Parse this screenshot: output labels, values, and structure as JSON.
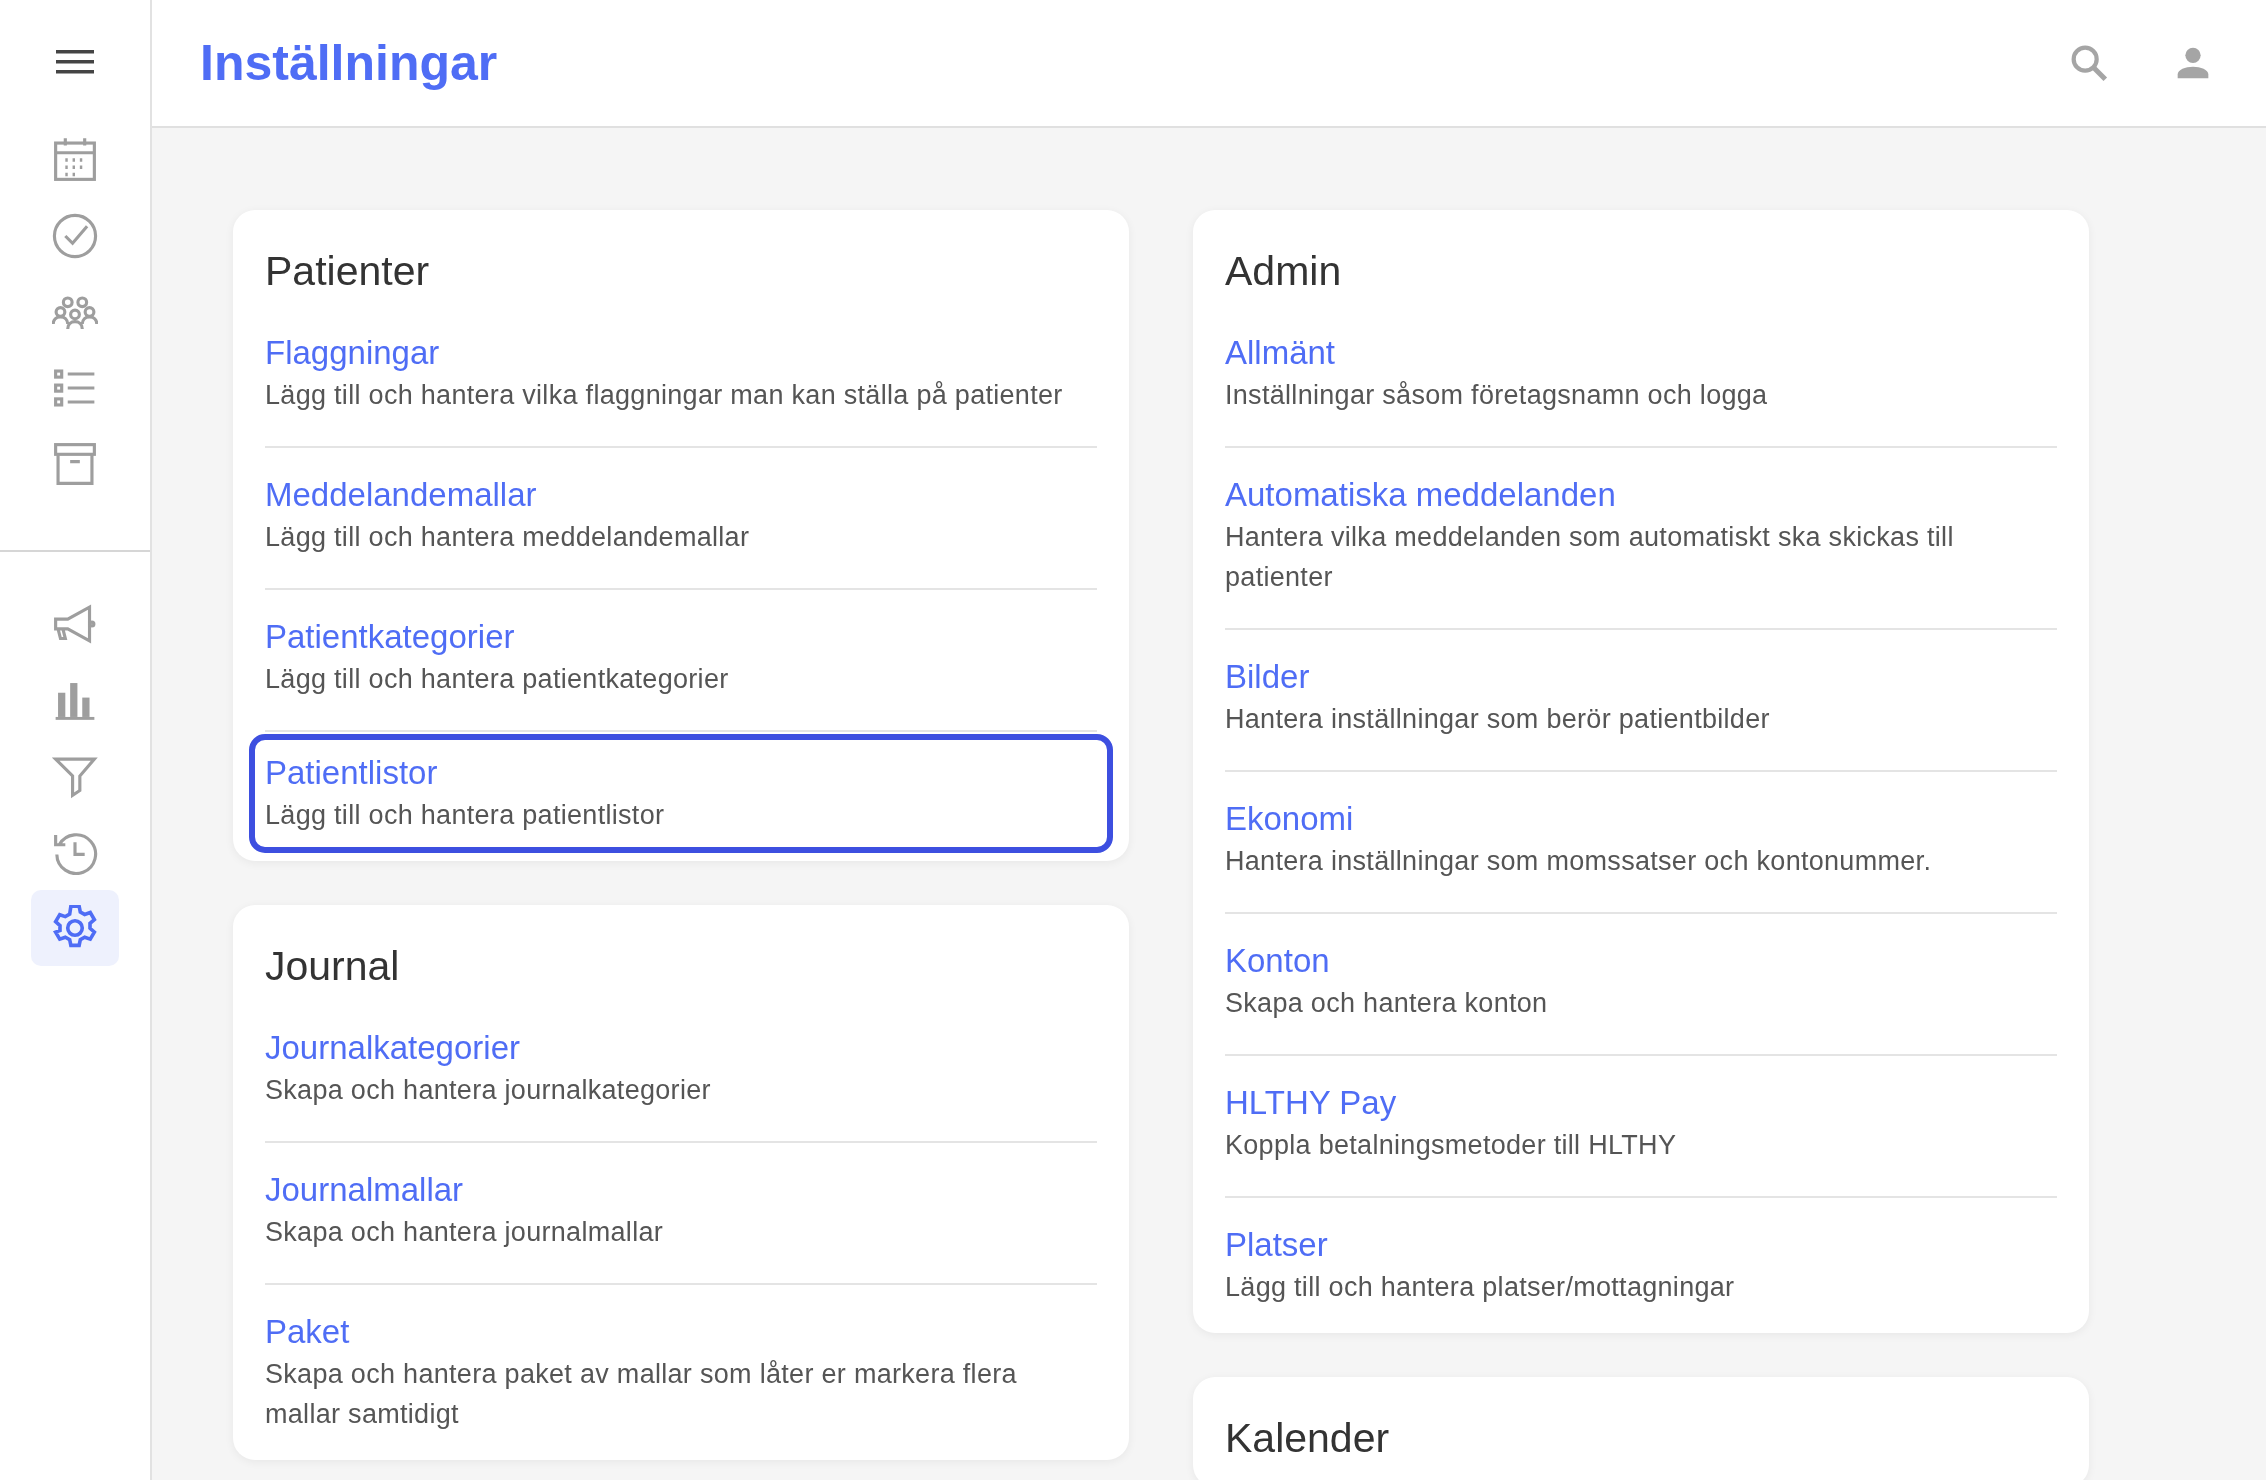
{
  "header": {
    "title": "Inställningar"
  },
  "nav": [
    {
      "kind": "calendar",
      "selected": false
    },
    {
      "kind": "check",
      "selected": false
    },
    {
      "kind": "people",
      "selected": false
    },
    {
      "kind": "list",
      "selected": false
    },
    {
      "kind": "archive",
      "selected": false
    },
    {
      "kind": "divider"
    },
    {
      "kind": "megaphone",
      "selected": false
    },
    {
      "kind": "chart",
      "selected": false
    },
    {
      "kind": "filter",
      "selected": false
    },
    {
      "kind": "history",
      "selected": false
    },
    {
      "kind": "settings",
      "selected": true
    }
  ],
  "columns": [
    [
      {
        "title": "Patienter",
        "items": [
          {
            "title": "Flaggningar",
            "description": "Lägg till och hantera vilka flaggningar man kan ställa på patienter",
            "focused": false
          },
          {
            "title": "Meddelandemallar",
            "description": "Lägg till och hantera meddelandemallar",
            "focused": false
          },
          {
            "title": "Patientkategorier",
            "description": "Lägg till och hantera patientkategorier",
            "focused": false
          },
          {
            "title": "Patientlistor",
            "description": "Lägg till och hantera patientlistor",
            "focused": true
          }
        ]
      },
      {
        "title": "Journal",
        "items": [
          {
            "title": "Journalkategorier",
            "description": "Skapa och hantera journalkategorier",
            "focused": false
          },
          {
            "title": "Journalmallar",
            "description": "Skapa och hantera journalmallar",
            "focused": false
          },
          {
            "title": "Paket",
            "description": "Skapa och hantera paket av mallar som låter er markera flera mallar samtidigt",
            "focused": false
          }
        ]
      }
    ],
    [
      {
        "title": "Admin",
        "items": [
          {
            "title": "Allmänt",
            "description": "Inställningar såsom företagsnamn och logga",
            "focused": false
          },
          {
            "title": "Automatiska meddelanden",
            "description": "Hantera vilka meddelanden som automatiskt ska skickas till patienter",
            "focused": false
          },
          {
            "title": "Bilder",
            "description": "Hantera inställningar som berör patientbilder",
            "focused": false
          },
          {
            "title": "Ekonomi",
            "description": "Hantera inställningar som momssatser och kontonummer.",
            "focused": false
          },
          {
            "title": "Konton",
            "description": "Skapa och hantera konton",
            "focused": false
          },
          {
            "title": "HLTHY Pay",
            "description": "Koppla betalningsmetoder till HLTHY",
            "focused": false
          },
          {
            "title": "Platser",
            "description": "Lägg till och hantera platser/mottagningar",
            "focused": false
          }
        ]
      },
      {
        "title": "Kalender"
      }
    ]
  ]
}
